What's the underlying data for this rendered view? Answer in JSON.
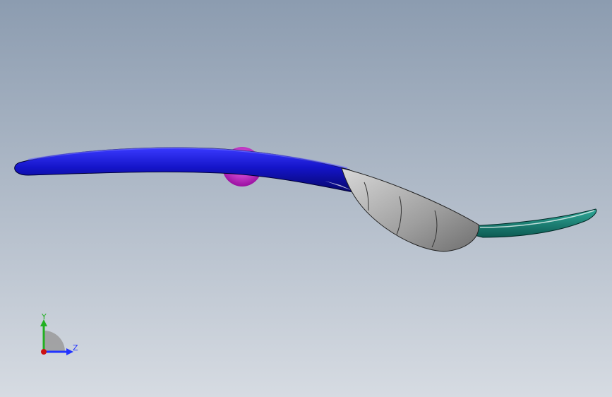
{
  "viewport": {
    "background_top": "#8c9cb0",
    "background_bottom": "#d6dbe2"
  },
  "model": {
    "parts": [
      {
        "name": "handle",
        "color": "#1a1ab8"
      },
      {
        "name": "knob",
        "color": "#c020c8"
      },
      {
        "name": "bowl",
        "color": "#a9a9a9"
      },
      {
        "name": "tip",
        "color": "#1a8a7a"
      }
    ]
  },
  "triad": {
    "y_label": "Y",
    "z_label": "Z",
    "y_color": "#22b022",
    "z_color": "#2233ff",
    "origin_color": "#cc1111"
  }
}
